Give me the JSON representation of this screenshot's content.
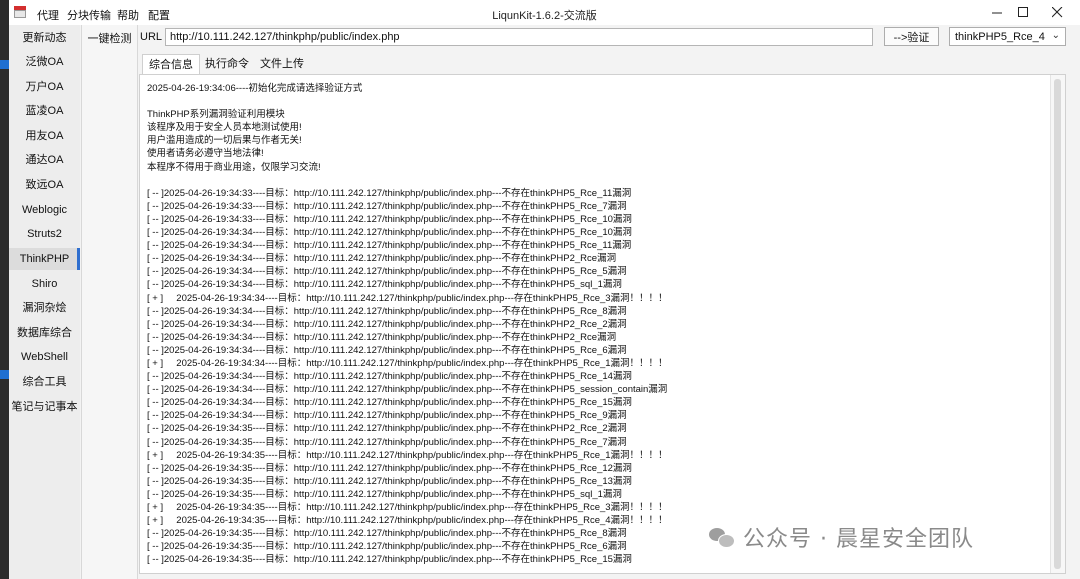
{
  "window": {
    "title": "LiqunKit-1.6.2-交流版",
    "menu": [
      "代理",
      "分块传输",
      "帮助",
      "配置"
    ]
  },
  "sidebar": {
    "items": [
      {
        "label": "更新动态"
      },
      {
        "label": "泛微OA"
      },
      {
        "label": "万户OA"
      },
      {
        "label": "蓝凌OA"
      },
      {
        "label": "用友OA"
      },
      {
        "label": "通达OA"
      },
      {
        "label": "致远OA"
      },
      {
        "label": "Weblogic"
      },
      {
        "label": "Struts2"
      },
      {
        "label": "ThinkPHP"
      },
      {
        "label": "Shiro"
      },
      {
        "label": "漏洞杂烩"
      },
      {
        "label": "数据库综合"
      },
      {
        "label": "WebShell"
      },
      {
        "label": "综合工具"
      },
      {
        "label": "笔记与记事本"
      }
    ],
    "selected": "ThinkPHP"
  },
  "subnav": {
    "label": "一键检测"
  },
  "url": {
    "label": "URL",
    "value": "http://10.111.242.127/thinkphp/public/index.php"
  },
  "verify_button": "-->验证",
  "version_select": "thinkPHP5_Rce_4",
  "tabs": [
    {
      "label": "综合信息",
      "active": true
    },
    {
      "label": "执行命令",
      "active": false
    },
    {
      "label": "文件上传",
      "active": false
    }
  ],
  "log": [
    "2025-04-26-19:34:06----初始化完成请选择验证方式",
    "",
    "ThinkPHP系列漏洞验证利用模块",
    "该程序及用于安全人员本地测试使用!",
    "用户滥用造成的一切后果与作者无关!",
    "使用者请务必遵守当地法律!",
    "本程序不得用于商业用途，仅限学习交流!",
    "",
    "[ -- ]2025-04-26-19:34:33----目标：http://10.111.242.127/thinkphp/public/index.php---不存在thinkPHP5_Rce_11漏洞",
    "[ -- ]2025-04-26-19:34:33----目标：http://10.111.242.127/thinkphp/public/index.php---不存在thinkPHP5_Rce_7漏洞",
    "[ -- ]2025-04-26-19:34:33----目标：http://10.111.242.127/thinkphp/public/index.php---不存在thinkPHP5_Rce_10漏洞",
    "[ -- ]2025-04-26-19:34:34----目标：http://10.111.242.127/thinkphp/public/index.php---不存在thinkPHP5_Rce_10漏洞",
    "[ -- ]2025-04-26-19:34:34----目标：http://10.111.242.127/thinkphp/public/index.php---不存在thinkPHP5_Rce_11漏洞",
    "[ -- ]2025-04-26-19:34:34----目标：http://10.111.242.127/thinkphp/public/index.php---不存在thinkPHP2_Rce漏洞",
    "[ -- ]2025-04-26-19:34:34----目标：http://10.111.242.127/thinkphp/public/index.php---不存在thinkPHP5_Rce_5漏洞",
    "[ -- ]2025-04-26-19:34:34----目标：http://10.111.242.127/thinkphp/public/index.php---不存在thinkPHP5_sql_1漏洞",
    "[ + ]     2025-04-26-19:34:34----目标：http://10.111.242.127/thinkphp/public/index.php---存在thinkPHP5_Rce_3漏洞！！！！",
    "[ -- ]2025-04-26-19:34:34----目标：http://10.111.242.127/thinkphp/public/index.php---不存在thinkPHP5_Rce_8漏洞",
    "[ -- ]2025-04-26-19:34:34----目标：http://10.111.242.127/thinkphp/public/index.php---不存在thinkPHP2_Rce_2漏洞",
    "[ -- ]2025-04-26-19:34:34----目标：http://10.111.242.127/thinkphp/public/index.php---不存在thinkPHP2_Rce漏洞",
    "[ -- ]2025-04-26-19:34:34----目标：http://10.111.242.127/thinkphp/public/index.php---不存在thinkPHP5_Rce_6漏洞",
    "[ + ]     2025-04-26-19:34:34----目标：http://10.111.242.127/thinkphp/public/index.php---存在thinkPHP5_Rce_1漏洞！！！！",
    "[ -- ]2025-04-26-19:34:34----目标：http://10.111.242.127/thinkphp/public/index.php---不存在thinkPHP5_Rce_14漏洞",
    "[ -- ]2025-04-26-19:34:34----目标：http://10.111.242.127/thinkphp/public/index.php---不存在thinkPHP5_session_contain漏洞",
    "[ -- ]2025-04-26-19:34:34----目标：http://10.111.242.127/thinkphp/public/index.php---不存在thinkPHP5_Rce_15漏洞",
    "[ -- ]2025-04-26-19:34:34----目标：http://10.111.242.127/thinkphp/public/index.php---不存在thinkPHP5_Rce_9漏洞",
    "[ -- ]2025-04-26-19:34:35----目标：http://10.111.242.127/thinkphp/public/index.php---不存在thinkPHP2_Rce_2漏洞",
    "[ -- ]2025-04-26-19:34:35----目标：http://10.111.242.127/thinkphp/public/index.php---不存在thinkPHP5_Rce_7漏洞",
    "[ + ]     2025-04-26-19:34:35----目标：http://10.111.242.127/thinkphp/public/index.php---存在thinkPHP5_Rce_1漏洞！！！！",
    "[ -- ]2025-04-26-19:34:35----目标：http://10.111.242.127/thinkphp/public/index.php---不存在thinkPHP5_Rce_12漏洞",
    "[ -- ]2025-04-26-19:34:35----目标：http://10.111.242.127/thinkphp/public/index.php---不存在thinkPHP5_Rce_13漏洞",
    "[ -- ]2025-04-26-19:34:35----目标：http://10.111.242.127/thinkphp/public/index.php---不存在thinkPHP5_sql_1漏洞",
    "[ + ]     2025-04-26-19:34:35----目标：http://10.111.242.127/thinkphp/public/index.php---存在thinkPHP5_Rce_3漏洞！！！！",
    "[ + ]     2025-04-26-19:34:35----目标：http://10.111.242.127/thinkphp/public/index.php---存在thinkPHP5_Rce_4漏洞！！！！",
    "[ -- ]2025-04-26-19:34:35----目标：http://10.111.242.127/thinkphp/public/index.php---不存在thinkPHP5_Rce_8漏洞",
    "[ -- ]2025-04-26-19:34:35----目标：http://10.111.242.127/thinkphp/public/index.php---不存在thinkPHP5_Rce_6漏洞",
    "[ -- ]2025-04-26-19:34:35----目标：http://10.111.242.127/thinkphp/public/index.php---不存在thinkPHP5_Rce_15漏洞"
  ],
  "watermark": "公众号 · 晨星安全团队"
}
